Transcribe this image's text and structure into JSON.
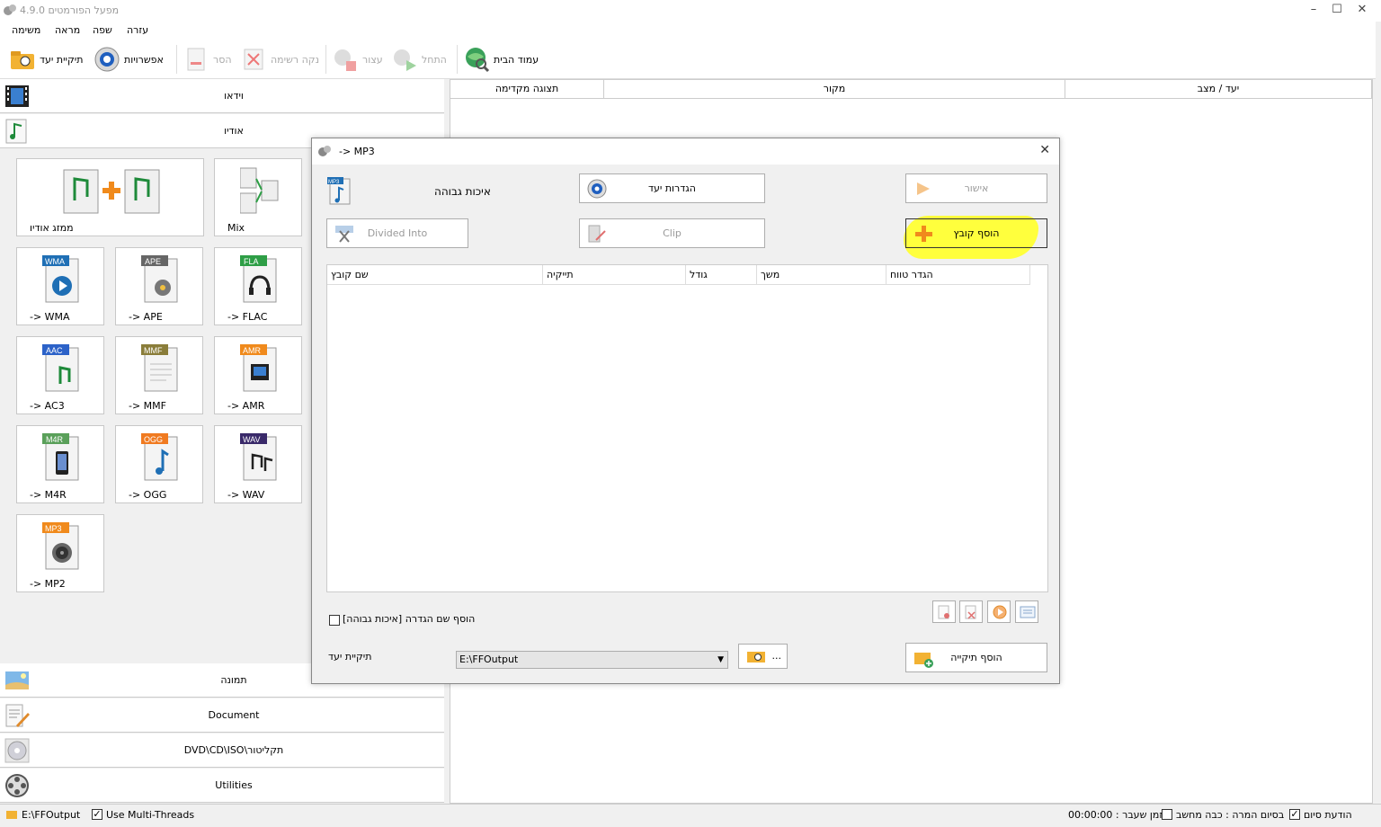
{
  "window": {
    "title": "מפעל הפורמטים 4.9.0",
    "minimize": "–",
    "maximize": "☐",
    "close": "✕"
  },
  "menu": [
    "עזרה",
    "שפה",
    "מראה",
    "משימה"
  ],
  "toolbar": {
    "home": "עמוד הבית",
    "start": "התחל",
    "stop": "עצור",
    "clear": "נקה רשימה",
    "remove": "הסר",
    "options": "אפשרויות",
    "output_folder": "תיקיית יעד"
  },
  "categories": {
    "video": "וידאו",
    "audio": "אודיו",
    "picture": "תמונה",
    "document": "Document",
    "dvd": "DVD\\CD\\ISO\\תקליטור",
    "utilities": "Utilities"
  },
  "audio_tiles": [
    {
      "label": "ממזג אודיו",
      "badge": ""
    },
    {
      "label": "Mix",
      "badge": ""
    },
    {
      "label": "-> WMA",
      "badge": "WMA",
      "color": "#1f6fb5"
    },
    {
      "label": "-> APE",
      "badge": "APE",
      "color": "#666666"
    },
    {
      "label": "-> FLAC",
      "badge": "FLA",
      "color": "#2e9e46"
    },
    {
      "label": "-> AC3",
      "badge": "AAC",
      "color": "#2c62c8"
    },
    {
      "label": "-> MMF",
      "badge": "MMF",
      "color": "#8a7d3a"
    },
    {
      "label": "-> AMR",
      "badge": "AMR",
      "color": "#f08a1c"
    },
    {
      "label": "-> M4R",
      "badge": "M4R",
      "color": "#5aa05a"
    },
    {
      "label": "-> OGG",
      "badge": "OGG",
      "color": "#f07a20"
    },
    {
      "label": "-> WAV",
      "badge": "WAV",
      "color": "#3a2a6a"
    },
    {
      "label": "-> MP2",
      "badge": "MP3",
      "color": "#f08a1c"
    }
  ],
  "task_list": {
    "headers": [
      "תצוגה מקדימה",
      "מקור",
      "יעד / מצב"
    ]
  },
  "dialog": {
    "title": "-> MP3",
    "close": "✕",
    "quality": "איכות גבוהה",
    "output_settings": "הגדרות יעד",
    "ok": "אישור",
    "divided_into": "Divided Into",
    "clip": "Clip",
    "add_file": "הוסף קובץ",
    "columns": [
      "שם קובץ",
      "תייקיה",
      "גודל",
      "משך",
      "הגדר טווח"
    ],
    "append_setting": "הוסף שם הגדרה [איכות גבוהה]",
    "output_folder_label": "תיקיית יעד",
    "output_folder_value": "E:\\FFOutput",
    "browse": "...",
    "add_folder": "הוסף תיקייה"
  },
  "status": {
    "path": "E:\\FFOutput",
    "multithreads": "Use Multi-Threads",
    "elapsed": "00:00:00 : זמן שעבר",
    "shutdown": "בסיום המרה : כבה מחשב",
    "notify": "הודעת סיום"
  }
}
